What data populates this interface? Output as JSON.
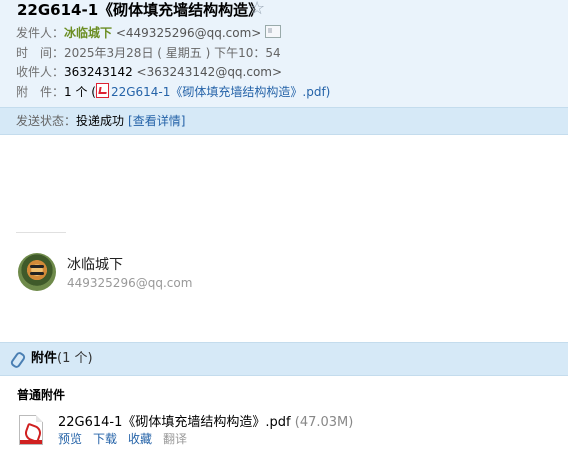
{
  "subject": "22G614-1《砌体填充墙结构构造》",
  "star_icon": "star-outline-icon",
  "from": {
    "label": "发件人：",
    "name": "冰临城下",
    "email": "<449325296@qq.com>"
  },
  "time": {
    "label": "时　间：",
    "value": "2025年3月28日 ( 星期五 ) 下午10：54"
  },
  "to": {
    "label": "收件人：",
    "name": "363243142",
    "email": "<363243142@qq.com>"
  },
  "attachment_row": {
    "label": "附　件：",
    "count": "1 个 (",
    "file": "22G614-1《砌体填充墙结构构造》.pdf",
    "close": ")"
  },
  "status": {
    "label": "发送状态：",
    "value": "投递成功",
    "link": "[查看详情]"
  },
  "signature": {
    "name": "冰临城下",
    "email": "449325296@qq.com"
  },
  "attachments": {
    "title": "附件",
    "count": "(1 个)",
    "section": "普通附件",
    "file_name": "22G614-1《砌体填充墙结构构造》.pdf",
    "file_size": "(47.03M)",
    "actions": [
      "预览",
      "下载",
      "收藏",
      "翻译"
    ]
  }
}
